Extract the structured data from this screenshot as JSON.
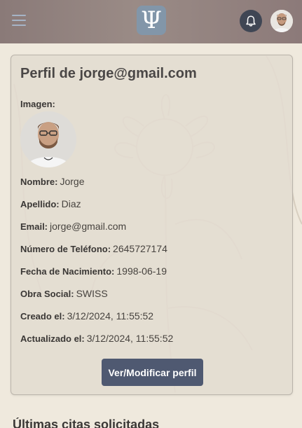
{
  "header": {
    "menu_icon": "hamburger-menu-icon",
    "logo_glyph": "Ψ",
    "notifications_icon": "bell-icon",
    "avatar_icon": "user-avatar"
  },
  "profile": {
    "title": "Perfil de jorge@gmail.com",
    "image_label": "Imagen:",
    "fields": [
      {
        "label": "Nombre:",
        "value": "Jorge"
      },
      {
        "label": "Apellido:",
        "value": "Diaz"
      },
      {
        "label": "Email:",
        "value": "jorge@gmail.com"
      },
      {
        "label": "Número de Teléfono:",
        "value": "2645727174"
      },
      {
        "label": "Fecha de Nacimiento:",
        "value": "1998-06-19"
      },
      {
        "label": "Obra Social:",
        "value": "SWISS"
      },
      {
        "label": "Creado el:",
        "value": "3/12/2024, 11:55:52"
      },
      {
        "label": "Actualizado el:",
        "value": "3/12/2024, 11:55:52"
      }
    ],
    "button_label": "Ver/Modificar perfil"
  },
  "bottom_heading": "Últimas citas solicitadas",
  "colors": {
    "header": "#8f7f7c",
    "button": "#4f5971",
    "logo_bg": "#8296a9",
    "bell_bg": "#3f4654"
  }
}
